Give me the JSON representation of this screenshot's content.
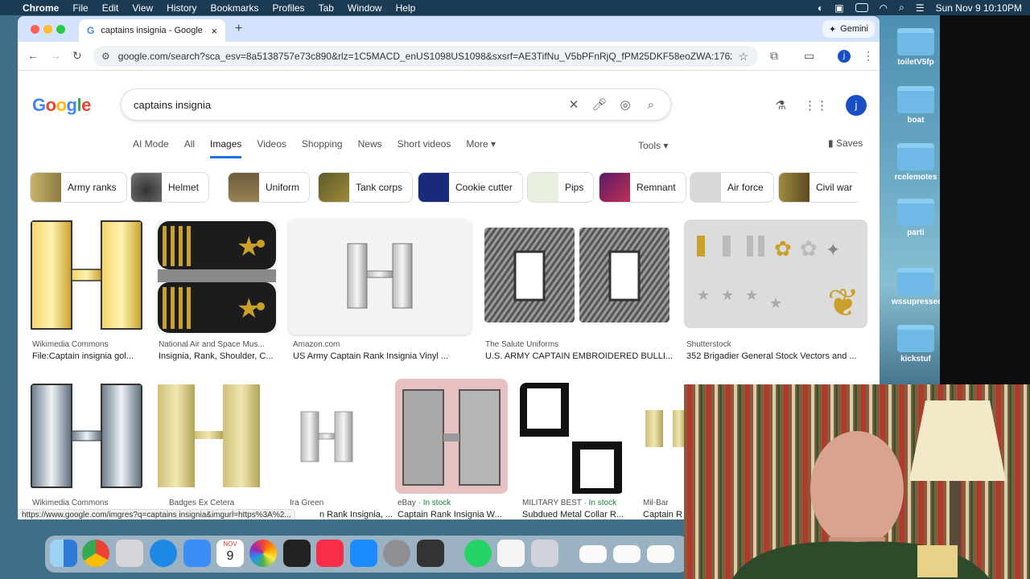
{
  "menubar": {
    "app": "Chrome",
    "items": [
      "File",
      "Edit",
      "View",
      "History",
      "Bookmarks",
      "Profiles",
      "Tab",
      "Window",
      "Help"
    ],
    "datetime": "Sun Nov 9  10:10PM"
  },
  "desktop": {
    "items": [
      "toiletV5fp",
      "boat",
      "rcelemotes",
      "parti",
      "wssupressed",
      "kickstuf"
    ]
  },
  "browser": {
    "tab_title": "captains insignia - Google Se",
    "gemini_label": "Gemini",
    "url": "google.com/search?sca_esv=8a5138757e73c890&rlz=1C5MACD_enUS1098US1098&sxsrf=AE3TifNu_V5bPFnRjQ_fPM25DKF58eoZWA:1762...",
    "profile_initial": "j"
  },
  "google": {
    "logo": "Google",
    "query": "captains insignia",
    "profile_initial": "j",
    "tabs": [
      "AI Mode",
      "All",
      "Images",
      "Videos",
      "Shopping",
      "News",
      "Short videos",
      "More ▾"
    ],
    "active_tab": "Images",
    "tools_label": "Tools ▾",
    "saves_label": "Saves",
    "chips": [
      "Army ranks",
      "Helmet",
      "Uniform",
      "Tank corps",
      "Cookie cutter",
      "Pips",
      "Remnant",
      "Air force",
      "Civil war"
    ],
    "results_row1": [
      {
        "source": "Wikimedia Commons",
        "caption": "File:Captain insignia gol..."
      },
      {
        "source": "National Air and Space Mus...",
        "caption": "Insignia, Rank, Shoulder, C..."
      },
      {
        "source": "Amazon.com",
        "caption": "US Army Captain Rank Insignia Vinyl ..."
      },
      {
        "source": "The Salute Uniforms",
        "caption": "U.S. ARMY CAPTAIN EMBROIDERED BULLI..."
      },
      {
        "source": "Shutterstock",
        "caption": "352 Brigadier General Stock Vectors and ..."
      }
    ],
    "results_row2": [
      {
        "source": "Wikimedia Commons",
        "caption": ""
      },
      {
        "source": "Badges Ex Cetera",
        "caption": ""
      },
      {
        "source": "Ira Green",
        "caption": "n Rank Insignia, ..."
      },
      {
        "source": "eBay",
        "stock": "In stock",
        "caption": "Captain Rank Insignia W..."
      },
      {
        "source": "MILITARY BEST",
        "stock": "In stock",
        "caption": "Subdued Metal Collar R..."
      },
      {
        "source": "Mil-Bar",
        "caption": "Captain R"
      }
    ],
    "status_url": "https://www.google.com/imgres?q=captains insignia&imgurl=https%3A%2..."
  },
  "dock": {
    "calendar_month": "NOV",
    "calendar_day": "9"
  }
}
